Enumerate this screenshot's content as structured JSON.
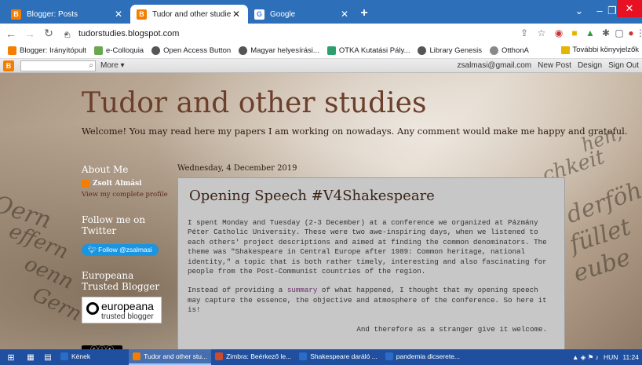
{
  "browser": {
    "tabs": [
      {
        "title": "Blogger: Posts",
        "icon": "blogger-icon",
        "active": false
      },
      {
        "title": "Tudor and other studies",
        "icon": "blogger-icon",
        "active": true
      },
      {
        "title": "Google",
        "icon": "google-icon",
        "active": false
      }
    ],
    "new_tab_label": "+",
    "url": "tudorstudies.blogspot.com",
    "bookmarks": [
      {
        "label": "Blogger: Irányítópult",
        "color": "#f57d00"
      },
      {
        "label": "e-Colloquia",
        "color": "#6aa84f"
      },
      {
        "label": "Open Access Button",
        "color": "#555555"
      },
      {
        "label": "Magyar helyesírási...",
        "color": "#555555"
      },
      {
        "label": "OTKA Kutatási Pály...",
        "color": "#2e9e6a"
      },
      {
        "label": "Library Genesis",
        "color": "#555555"
      },
      {
        "label": "OtthonA",
        "color": "#888888"
      }
    ],
    "bookmarks_more": "További könyvjelzők"
  },
  "navbar": {
    "more_label": "More ▾",
    "email": "zsalmasi@gmail.com",
    "new_post": "New Post",
    "design": "Design",
    "sign_out": "Sign Out"
  },
  "blog": {
    "title": "Tudor and other studies",
    "description": "Welcome! You may read here my papers I am working on nowadays. Any comment would make me happy and grateful."
  },
  "sidebar": {
    "about_heading": "About Me",
    "profile_name": "Zsolt Almási",
    "profile_link": "View my complete profile",
    "follow_heading": "Follow me on Twitter",
    "follow_button": "Follow @zsalmasi",
    "europeana_heading": "Europeana Trusted Blogger",
    "europeana_name": "europeana",
    "europeana_sub": "trusted blogger"
  },
  "post": {
    "date": "Wednesday, 4 December 2019",
    "title": "Opening Speech #V4Shakespeare",
    "para1": "I spent Monday and Tuesday (2-3 December) at a conference we organized at Pázmány Péter Catholic University. These were two awe-inspiring days, when we listened to each others' project descriptions and aimed at finding the common denominators. The theme was \"Shakespeare in Central Europe after 1989: Common heritage, national identity,\" a topic that is both rather timely, interesting and also fascinating for people from the Post-Communist countries of the region.",
    "para2_before": "Instead of providing a ",
    "para2_keyword": "summary",
    "para2_after": " of what happened, I thought that my opening speech may capture the essence, the objective and atmosphere of the conference. So here it is!",
    "quote": "And therefore as a stranger give it welcome."
  },
  "taskbar": {
    "apps": [
      {
        "label": "Kének",
        "color": "#2a6cc7",
        "active": false
      },
      {
        "label": "Tudor and other stu...",
        "color": "#f57d00",
        "active": true
      },
      {
        "label": "Zimbra: Beérkező le...",
        "color": "#d04a2a",
        "active": false
      },
      {
        "label": "Shakespeare daráló ...",
        "color": "#2a6cc7",
        "active": false
      },
      {
        "label": "pandemia dicserete...",
        "color": "#2a6cc7",
        "active": false
      }
    ],
    "lang": "HUN",
    "time": "11:24"
  }
}
